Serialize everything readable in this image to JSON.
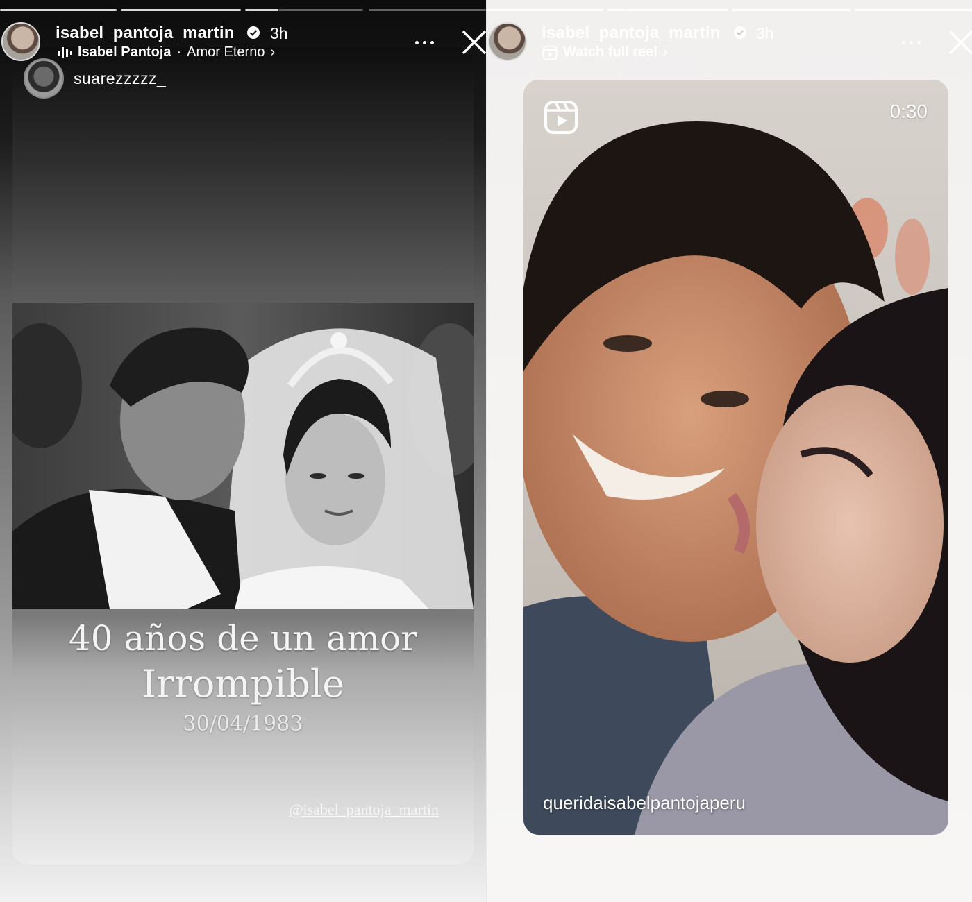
{
  "left_story": {
    "username": "isabel_pantoja_martin",
    "time_ago": "3h",
    "music": {
      "artist": "Isabel Pantoja",
      "separator": "·",
      "song": "Amor Eterno",
      "chevron": "›"
    },
    "mentioned_user": "suarezzzzz_",
    "caption_line1": "40 años de un amor",
    "caption_line2": "Irrompible",
    "date": "30/04/1983",
    "watermark": "@isabel_pantoja_martin"
  },
  "right_story": {
    "username": "isabel_pantoja_martin",
    "time_ago": "3h",
    "watch_label": "Watch full reel",
    "chevron": "›",
    "reel_duration": "0:30",
    "reel_account": "queridaisabelpantojaperu"
  },
  "icons": {
    "verified": "verified-badge-icon",
    "more": "more-options-icon",
    "close": "close-icon",
    "music": "music-bars-icon",
    "reel": "reel-icon"
  },
  "colors": {
    "text": "#ffffff",
    "progress_filled": "#d9d9d9",
    "progress_empty": "#555555"
  }
}
